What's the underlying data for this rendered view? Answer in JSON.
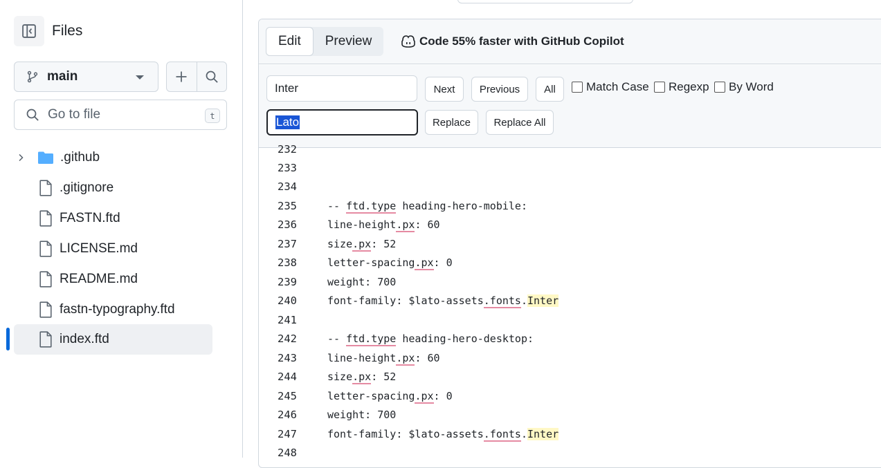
{
  "sidebar": {
    "title": "Files",
    "branch": "main",
    "goto_placeholder": "Go to file",
    "goto_shortcut": "t",
    "items": [
      {
        "label": ".github",
        "type": "folder"
      },
      {
        "label": ".gitignore",
        "type": "file"
      },
      {
        "label": "FASTN.ftd",
        "type": "file"
      },
      {
        "label": "LICENSE.md",
        "type": "file"
      },
      {
        "label": "README.md",
        "type": "file"
      },
      {
        "label": "fastn-typography.ftd",
        "type": "file"
      },
      {
        "label": "index.ftd",
        "type": "file",
        "active": true
      }
    ]
  },
  "editor": {
    "tabs": {
      "edit": "Edit",
      "preview": "Preview"
    },
    "copilot_text": "Code 55% faster with GitHub Copilot",
    "search": {
      "find_value": "Inter",
      "replace_value": "Lato",
      "next": "Next",
      "previous": "Previous",
      "all": "All",
      "match_case": "Match Case",
      "regexp": "Regexp",
      "by_word": "By Word",
      "replace": "Replace",
      "replace_all": "Replace All"
    },
    "lines": [
      {
        "n": "232",
        "t": ""
      },
      {
        "n": "233",
        "t": ""
      },
      {
        "n": "234",
        "t": ""
      },
      {
        "n": "235",
        "t": "-- ftd.type heading-hero-mobile:"
      },
      {
        "n": "236",
        "t": "line-height.px: 60"
      },
      {
        "n": "237",
        "t": "size.px: 52"
      },
      {
        "n": "238",
        "t": "letter-spacing.px: 0"
      },
      {
        "n": "239",
        "t": "weight: 700"
      },
      {
        "n": "240",
        "t": "font-family: $lato-assets.fonts.Inter"
      },
      {
        "n": "241",
        "t": ""
      },
      {
        "n": "242",
        "t": "-- ftd.type heading-hero-desktop:"
      },
      {
        "n": "243",
        "t": "line-height.px: 60"
      },
      {
        "n": "244",
        "t": "size.px: 52"
      },
      {
        "n": "245",
        "t": "letter-spacing.px: 0"
      },
      {
        "n": "246",
        "t": "weight: 700"
      },
      {
        "n": "247",
        "t": "font-family: $lato-assets.fonts.Inter"
      },
      {
        "n": "248",
        "t": ""
      }
    ]
  },
  "colors": {
    "accent": "#0969da",
    "match_highlight": "#fff8c5",
    "selection": "#1a56d6"
  }
}
